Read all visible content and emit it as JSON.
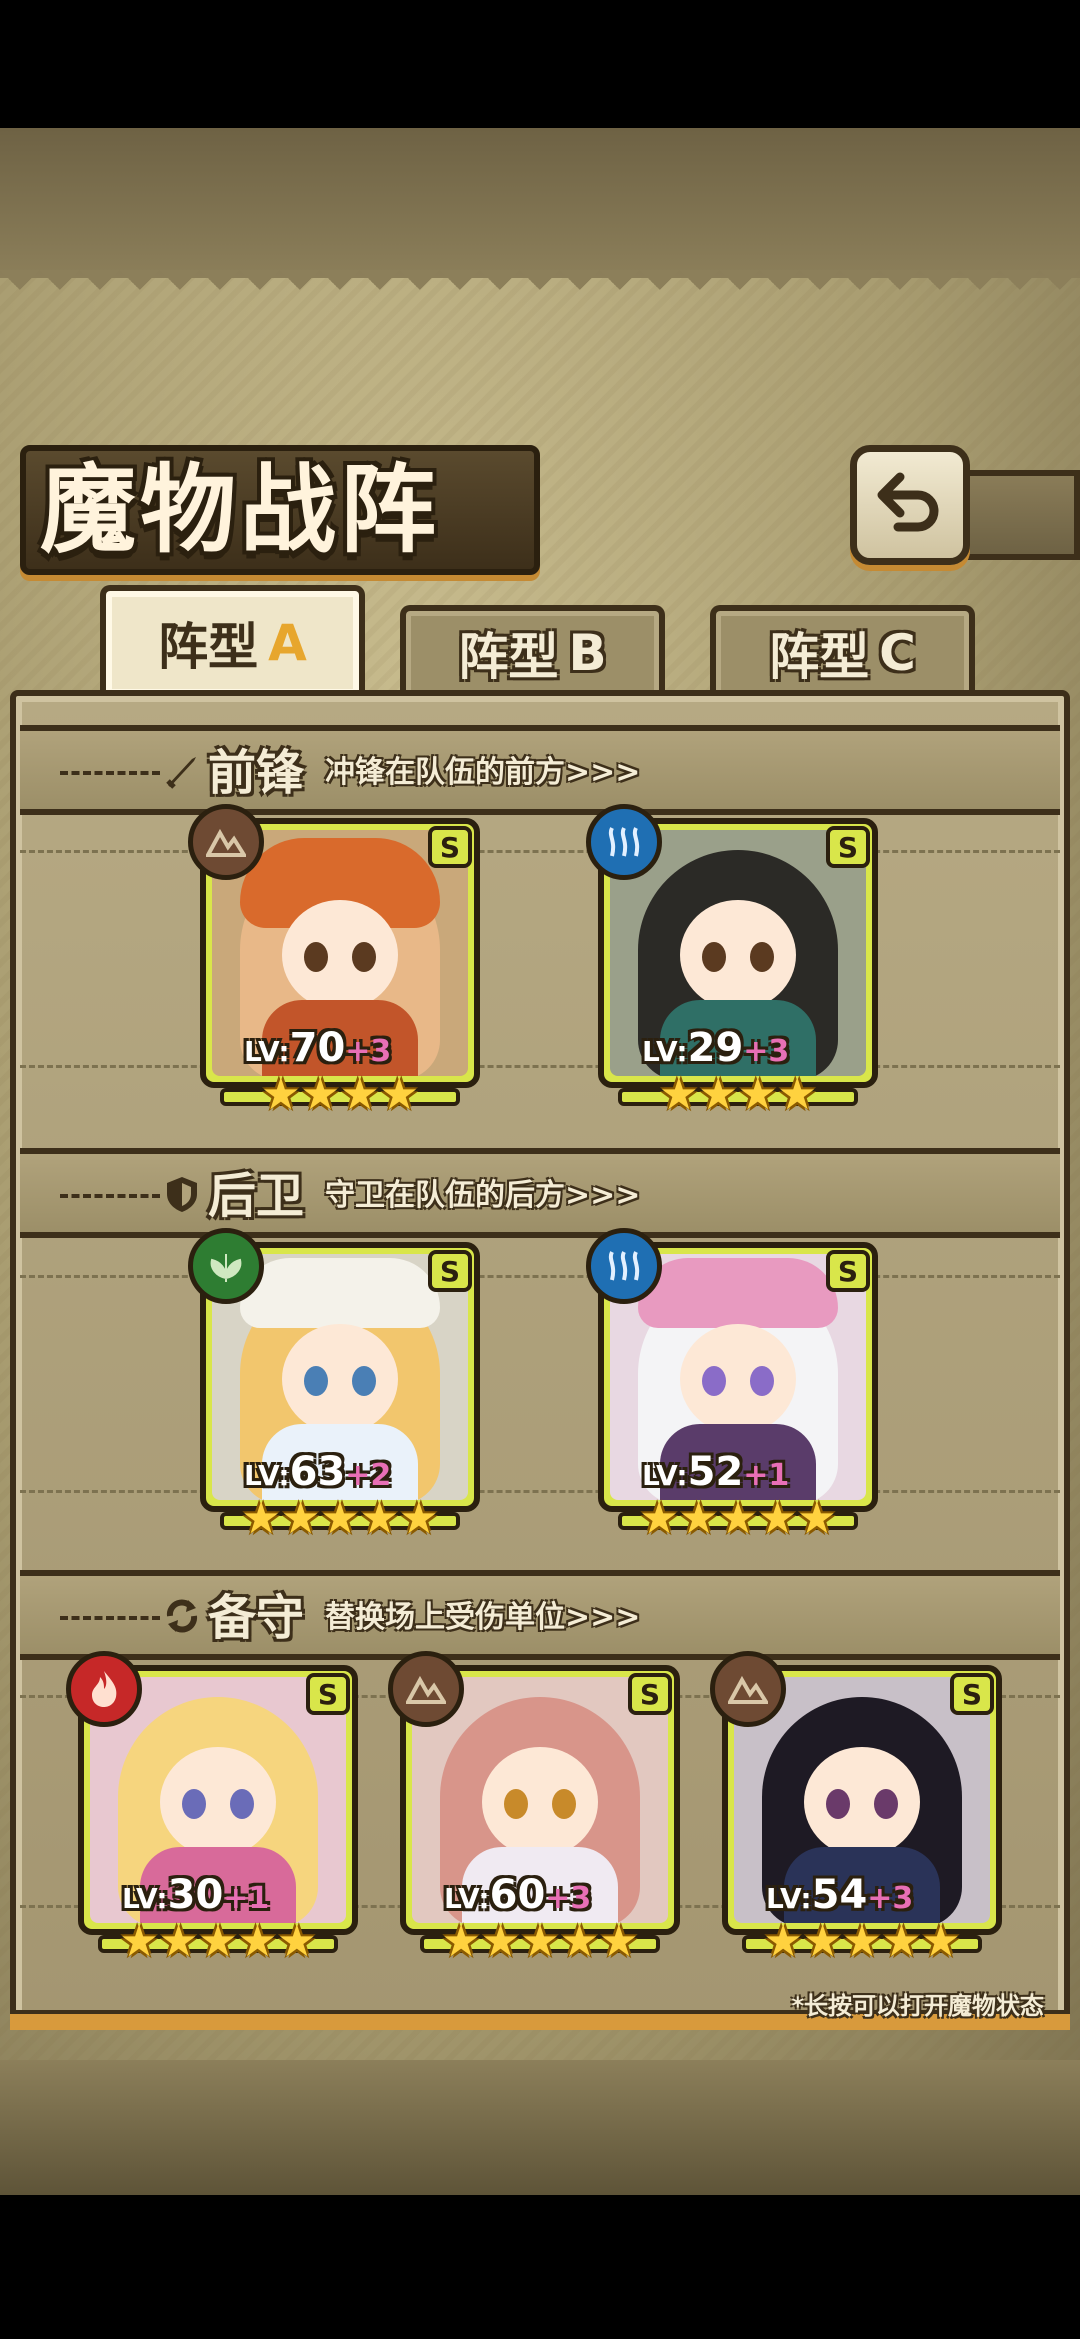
{
  "header": {
    "title": "魔物战阵"
  },
  "tabs": [
    {
      "label": "阵型",
      "suffix": "A"
    },
    {
      "label": "阵型",
      "suffix": "B"
    },
    {
      "label": "阵型",
      "suffix": "C"
    }
  ],
  "sections": {
    "front": {
      "name": "前锋",
      "desc": "冲锋在队伍的前方>>>"
    },
    "rear": {
      "name": "后卫",
      "desc": "守卫在队伍的后方>>>"
    },
    "reserve": {
      "name": "备守",
      "desc": "替换场上受伤单位>>>"
    }
  },
  "units": {
    "front": [
      {
        "lv_prefix": "LV:",
        "level": "70",
        "plus": "+3",
        "rarity": "S",
        "element": "earth",
        "stars": "★★★★"
      },
      {
        "lv_prefix": "LV:",
        "level": "29",
        "plus": "+3",
        "rarity": "S",
        "element": "water",
        "stars": "★★★★"
      }
    ],
    "rear": [
      {
        "lv_prefix": "LV:",
        "level": "63",
        "plus": "+2",
        "rarity": "S",
        "element": "wood",
        "stars": "★★★★★"
      },
      {
        "lv_prefix": "LV:",
        "level": "52",
        "plus": "+1",
        "rarity": "S",
        "element": "water",
        "stars": "★★★★★"
      }
    ],
    "reserve": [
      {
        "lv_prefix": "LV:",
        "level": "30",
        "plus": "+1",
        "rarity": "S",
        "element": "fire",
        "stars": "★★★★★"
      },
      {
        "lv_prefix": "LV:",
        "level": "60",
        "plus": "+3",
        "rarity": "S",
        "element": "earth",
        "stars": "★★★★★"
      },
      {
        "lv_prefix": "LV:",
        "level": "54",
        "plus": "+3",
        "rarity": "S",
        "element": "earth",
        "stars": "★★★★★"
      }
    ]
  },
  "footer": {
    "hint": "*长按可以打开魔物状态"
  },
  "colors": {
    "frame": "#d9e64a",
    "outline": "#2b200f",
    "accent": "#e7a62d",
    "plus": "#e86fb5"
  }
}
